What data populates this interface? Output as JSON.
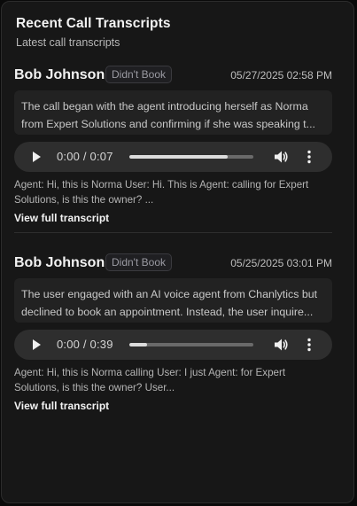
{
  "card": {
    "title": "Recent Call Transcripts",
    "subtitle": "Latest call transcripts"
  },
  "calls": [
    {
      "name": "Bob Johnson",
      "status": "Didn't Book",
      "date": "05/27/2025 02:58 PM",
      "summary_line_1": "The call began with the agent introducing herself as Norma",
      "summary_line_2": "from Expert Solutions and confirming if she was speaking t...",
      "audio_time": "0:00 / 0:07",
      "audio_progress": 0.79,
      "preview": "Agent: Hi, this is Norma User: Hi. This is Agent: calling for Expert Solutions, is this the owner? ...",
      "link_label": "View full transcript"
    },
    {
      "name": "Bob Johnson",
      "status": "Didn't Book",
      "date": "05/25/2025 03:01 PM",
      "summary_line_1": "The user engaged with an AI voice agent from Chanlytics but",
      "summary_line_2": "declined to book an appointment. Instead, the user inquire...",
      "audio_time": "0:00 / 0:39",
      "audio_progress": 0.14,
      "preview": "Agent: Hi, this is Norma calling User: I just Agent: for Expert Solutions, is this the owner? User...",
      "link_label": "View full transcript"
    }
  ],
  "icons": {
    "play": "play-icon",
    "volume": "volume-icon",
    "menu": "more-vertical-icon"
  },
  "colors": {
    "card_bg": "#171717",
    "badge_text": "#9a9aa2",
    "player_bg": "#2e2e2e"
  }
}
